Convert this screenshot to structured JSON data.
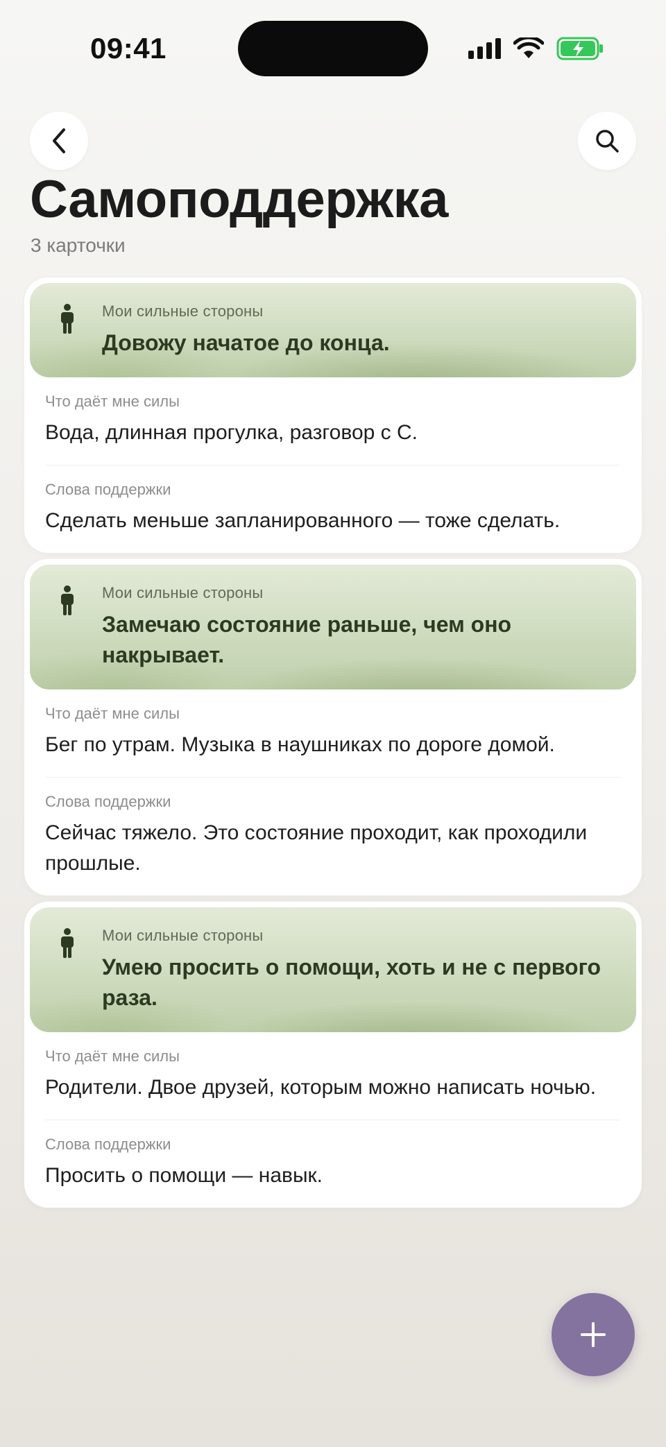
{
  "status_bar": {
    "time": "09:41",
    "icons": [
      "signal-icon",
      "wifi-icon",
      "battery-charging-icon"
    ],
    "battery_color": "#35c759"
  },
  "header": {
    "back_icon": "chevron-left-icon",
    "search_icon": "search-icon",
    "title": "Самоподдержка",
    "subtitle": "3 карточки"
  },
  "cards": [
    {
      "head_label": "Мои сильные стороны",
      "head_text": "Довожу начатое до конца.",
      "sections": [
        {
          "label": "Что даёт мне силы",
          "text": "Вода, длинная прогулка, разговор с С."
        },
        {
          "label": "Слова поддержки",
          "text": "Сделать меньше запланированного — тоже сделать."
        }
      ]
    },
    {
      "head_label": "Мои сильные стороны",
      "head_text": "Замечаю состояние раньше, чем оно накрывает.",
      "sections": [
        {
          "label": "Что даёт мне силы",
          "text": "Бег по утрам. Музыка в наушниках по дороге домой."
        },
        {
          "label": "Слова поддержки",
          "text": "Сейчас тяжело. Это состояние проходит, как проходили прошлые."
        }
      ]
    },
    {
      "head_label": "Мои сильные стороны",
      "head_text": "Умею просить о помощи, хоть и не с первого раза.",
      "sections": [
        {
          "label": "Что даёт мне силы",
          "text": "Родители. Двое друзей, которым можно написать ночью."
        },
        {
          "label": "Слова поддержки",
          "text": "Просить о помощи — навык."
        }
      ]
    }
  ],
  "fab": {
    "icon": "plus-icon",
    "color": "#84739f"
  },
  "colors": {
    "card_head_text": "#2c3a22",
    "accent_green": "#cfdcbf",
    "background": "#f2f1ee"
  }
}
